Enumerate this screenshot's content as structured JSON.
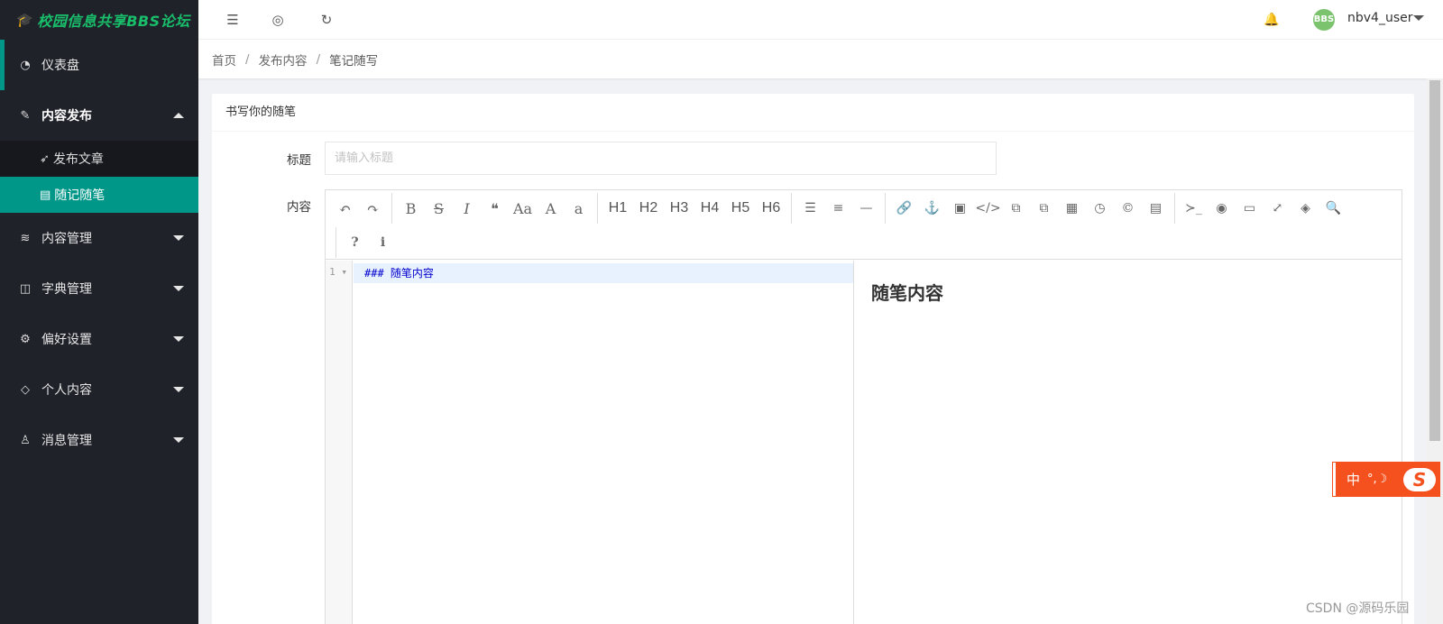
{
  "sidebar": {
    "brand": "校园信息共享BBS论坛",
    "items": [
      {
        "label": "仪表盘"
      },
      {
        "label": "内容发布"
      },
      {
        "label": "内容管理"
      },
      {
        "label": "字典管理"
      },
      {
        "label": "偏好设置"
      },
      {
        "label": "个人内容"
      },
      {
        "label": "消息管理"
      }
    ],
    "subitems": [
      {
        "label": "发布文章"
      },
      {
        "label": "随记随笔"
      }
    ],
    "colors": {
      "bg": "#20222a",
      "accent": "#009688",
      "brand": "#19be6b"
    }
  },
  "header": {
    "username": "nbv4_user",
    "avatar_text": "BBS"
  },
  "breadcrumb": {
    "items": [
      "首页",
      "发布内容",
      "笔记随写"
    ],
    "separator": "/"
  },
  "form": {
    "card_title": "书写你的随笔",
    "title_label": "标题",
    "title_placeholder": "请输入标题",
    "title_value": "",
    "content_label": "内容"
  },
  "editor": {
    "toolbar_row1": [
      "↶",
      "↷",
      "B",
      "S",
      "I",
      "❝",
      "Aa",
      "A",
      "a",
      "H1",
      "H2",
      "H3",
      "H4",
      "H5",
      "H6",
      "☰",
      "≡",
      "—",
      "🔗",
      "⚓",
      "▣",
      "</>",
      "⧉",
      "⧉",
      "▦",
      "◷",
      "©",
      "▤",
      "≻_",
      "◉",
      "▭",
      "⤢",
      "◈",
      "🔍"
    ],
    "toolbar_row2": [
      "?",
      "i"
    ],
    "line_number": "1",
    "code_text": "### 随笔内容",
    "preview_heading": "随笔内容"
  },
  "ime": {
    "lang": "中",
    "punc": "°,☽",
    "logo": "S"
  },
  "watermark": "CSDN @源码乐园"
}
